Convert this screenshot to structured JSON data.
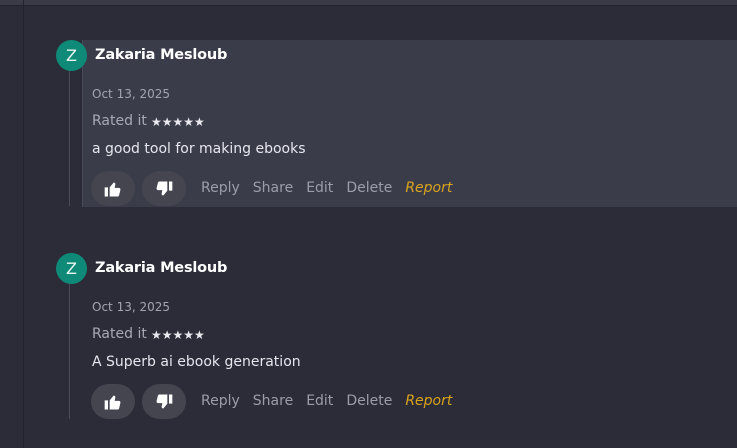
{
  "reviews": [
    {
      "avatar_letter": "Z",
      "author": "Zakaria Mesloub",
      "date": "Oct 13, 2025",
      "rated_label": "Rated it",
      "stars": "★★★★★",
      "rating": 5,
      "text": "a good tool for making ebooks",
      "actions": {
        "reply": "Reply",
        "share": "Share",
        "edit": "Edit",
        "delete": "Delete",
        "report": "Report"
      }
    },
    {
      "avatar_letter": "Z",
      "author": "Zakaria Mesloub",
      "date": "Oct 13, 2025",
      "rated_label": "Rated it",
      "stars": "★★★★★",
      "rating": 5,
      "text": "A Superb ai ebook generation",
      "actions": {
        "reply": "Reply",
        "share": "Share",
        "edit": "Edit",
        "delete": "Delete",
        "report": "Report"
      }
    }
  ],
  "colors": {
    "background": "#2b2c37",
    "highlight": "#3b3c4a",
    "avatar": "#0f8a78",
    "report": "#d9a31d"
  },
  "icons": {
    "like": "thumbs-up-icon",
    "dislike": "thumbs-down-icon"
  }
}
